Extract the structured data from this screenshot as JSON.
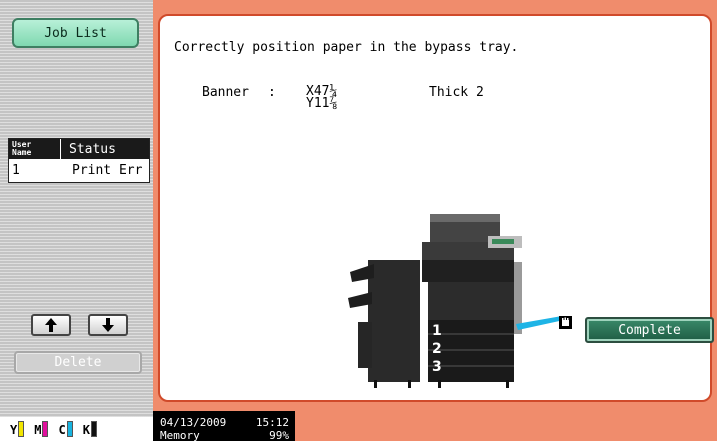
{
  "sidebar": {
    "job_list_label": "Job List",
    "table": {
      "header_user_line1": "User",
      "header_user_line2": "Name",
      "header_status": "Status",
      "rows": [
        {
          "user": "1",
          "status": "Print Err"
        }
      ]
    },
    "delete_label": "Delete",
    "toner": [
      {
        "label": "Y",
        "color": "#f2e600"
      },
      {
        "label": "M",
        "color": "#e0109c"
      },
      {
        "label": "C",
        "color": "#18b4e0"
      },
      {
        "label": "K",
        "color": "#111111"
      }
    ]
  },
  "main": {
    "message": "Correctly position paper in the bypass tray.",
    "paper": {
      "type": "Banner",
      "separator": ":",
      "size_x": "X47¼",
      "size_y": "Y11⅞",
      "weight": "Thick 2"
    },
    "tray_numbers": [
      "1",
      "2",
      "3"
    ],
    "complete_label": "Complete"
  },
  "status": {
    "date": "04/13/2009",
    "time": "15:12",
    "memory_label": "Memory",
    "memory_value": "99%"
  },
  "colors": {
    "frame": "#f08c6c",
    "accent_green": "#1f5c44",
    "bypass_blue": "#1eb4e6"
  }
}
